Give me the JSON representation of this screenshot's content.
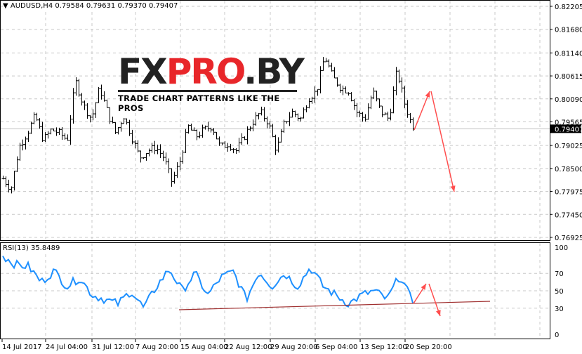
{
  "header": {
    "symbol": "AUDUSD,H4",
    "ohlc": "0.79584 0.79631 0.79370 0.79407"
  },
  "logo": {
    "main_black_1": "FX",
    "main_red": "PRO",
    "main_black_2": ".BY",
    "tagline": "TRADE CHART PATTERNS LIKE THE PROS"
  },
  "rsi_label": "RSI(13) 35.8489",
  "colors": {
    "bars": "#000000",
    "rsi_line": "#1e90ff",
    "arrows": "#ff4d4d",
    "trendline": "#a03030",
    "grid": "#c8c8c8"
  },
  "chart_data": [
    {
      "type": "ohlc",
      "title": "AUDUSD,H4",
      "ylim": [
        0.76925,
        0.82205
      ],
      "y_ticks": [
        "0.82205",
        "0.81680",
        "0.81140",
        "0.80615",
        "0.80090",
        "0.79565",
        "0.79025",
        "0.78500",
        "0.77975",
        "0.77450",
        "0.76925"
      ],
      "current_price": "0.79407",
      "x_ticks": [
        "14 Jul 2017",
        "24 Jul 04:00",
        "31 Jul 12:00",
        "7 Aug 20:00",
        "15 Aug 04:00",
        "22 Aug 12:00",
        "29 Aug 20:00",
        "6 Sep 04:00",
        "13 Sep 12:00",
        "20 Sep 20:00"
      ],
      "close_keypoints": [
        0.78267,
        0.78027,
        0.78988,
        0.79308,
        0.79708,
        0.79148,
        0.79388,
        0.79308,
        0.79148,
        0.80508,
        0.79948,
        0.79628,
        0.80348,
        0.79788,
        0.79308,
        0.79708,
        0.79228,
        0.78748,
        0.78908,
        0.78988,
        0.78748,
        0.78187,
        0.78668,
        0.79468,
        0.79228,
        0.79388,
        0.79468,
        0.78988,
        0.79068,
        0.78908,
        0.79228,
        0.79548,
        0.79788,
        0.79548,
        0.78908,
        0.79548,
        0.79788,
        0.79628,
        0.80108,
        0.80268,
        0.81068,
        0.80588,
        0.80348,
        0.80268,
        0.79788,
        0.79628,
        0.80268,
        0.79788,
        0.79628,
        0.80748,
        0.79948,
        0.79407
      ],
      "forecast_arrows": [
        "up",
        "down"
      ]
    },
    {
      "type": "line",
      "title": "RSI(13)",
      "ylim": [
        0,
        100
      ],
      "y_ticks": [
        "100",
        "70",
        "50",
        "30",
        "0"
      ],
      "values": [
        90,
        80,
        78,
        60,
        73,
        55,
        65,
        45,
        40,
        35,
        50,
        30,
        55,
        75,
        50,
        70,
        45,
        65,
        72,
        40,
        72,
        55,
        70,
        55,
        77,
        55,
        45,
        35,
        45,
        50,
        40,
        68,
        36
      ],
      "trendline": "rising support",
      "forecast_arrows": [
        "up",
        "down"
      ]
    }
  ]
}
